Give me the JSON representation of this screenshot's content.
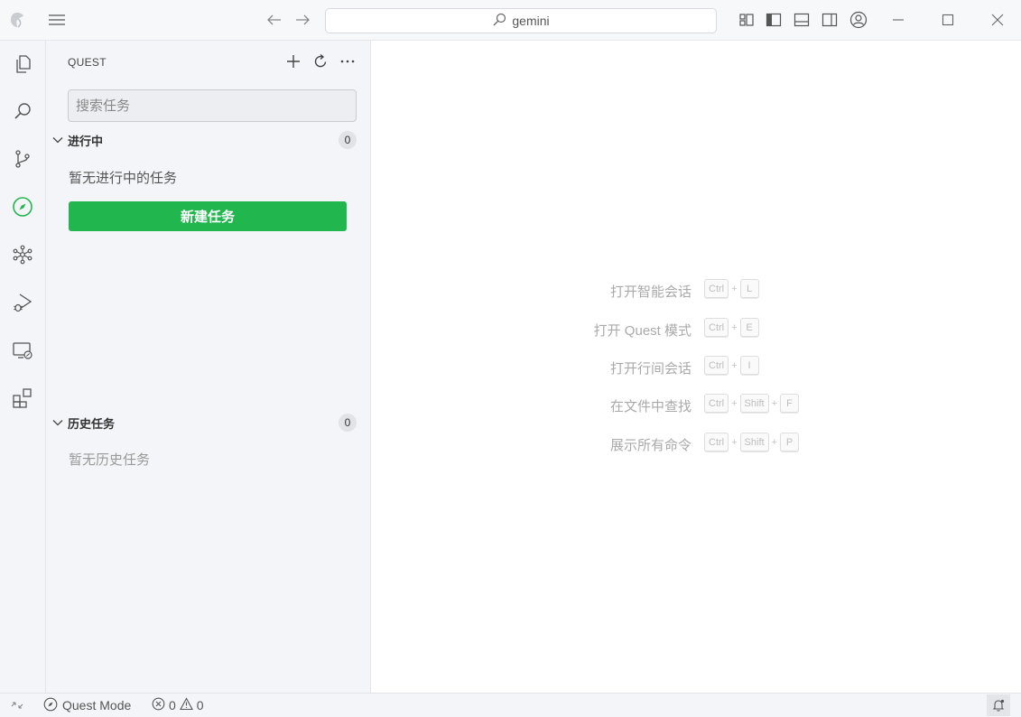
{
  "titlebar": {
    "search_text": "gemini",
    "icons": [
      "app-logo-icon",
      "menu-icon",
      "back-arrow-icon",
      "forward-arrow-icon",
      "search-icon",
      "customize-layout-icon",
      "toggle-sidebar-icon",
      "toggle-panel-icon",
      "toggle-secondary-sidebar-icon",
      "account-icon",
      "minimize-icon",
      "maximize-icon",
      "close-icon"
    ]
  },
  "activitybar": {
    "items": [
      "explorer-icon",
      "search-icon",
      "source-control-icon",
      "quest-icon",
      "graph-icon",
      "run-debug-icon",
      "remote-explorer-icon",
      "extensions-icon"
    ],
    "active": "quest-icon",
    "accent_color": "#22b64f"
  },
  "sidebar": {
    "title": "QUEST",
    "search_placeholder": "搜索任务",
    "in_progress": {
      "label": "进行中",
      "count": "0",
      "empty_text": "暂无进行中的任务",
      "new_task_label": "新建任务"
    },
    "history": {
      "label": "历史任务",
      "count": "0",
      "empty_text": "暂无历史任务"
    }
  },
  "editor": {
    "hints": [
      {
        "label": "打开智能会话",
        "keys": [
          "Ctrl",
          "L"
        ]
      },
      {
        "label": "打开 Quest 模式",
        "keys": [
          "Ctrl",
          "E"
        ]
      },
      {
        "label": "打开行间会话",
        "keys": [
          "Ctrl",
          "I"
        ]
      },
      {
        "label": "在文件中查找",
        "keys": [
          "Ctrl",
          "Shift",
          "F"
        ]
      },
      {
        "label": "展示所有命令",
        "keys": [
          "Ctrl",
          "Shift",
          "P"
        ]
      }
    ]
  },
  "statusbar": {
    "mode_label": "Quest Mode",
    "errors": "0",
    "warnings": "0"
  }
}
